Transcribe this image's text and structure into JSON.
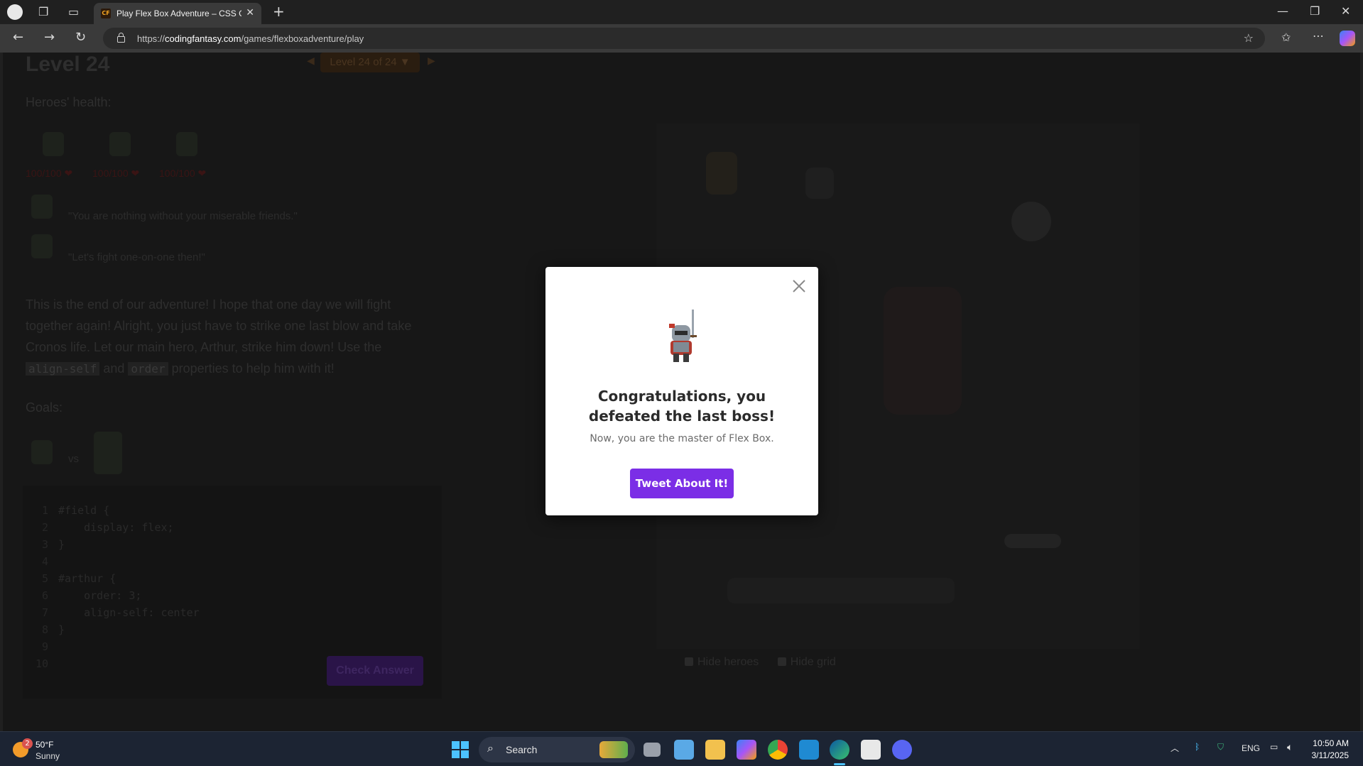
{
  "browser": {
    "tab_title": "Play Flex Box Adventure – CSS Ga",
    "tab_favicon_text": "CF",
    "url_prefix": "https://",
    "url_domain": "codingfantasy.com",
    "url_path": "/games/flexboxadventure/play"
  },
  "page": {
    "level_title": "Level 24",
    "level_nav": "Level 24 of 24 ▼",
    "health_label": "Heroes' health:",
    "hero_hp": [
      "100/100 ❤",
      "100/100 ❤",
      "100/100 ❤"
    ],
    "quote_boss": "\"You are nothing without your miserable friends.\"",
    "quote_hero": "\"Let's fight one-on-one then!\"",
    "story_part1": "This is the end of our adventure! I hope that one day we will fight together again! Alright, you just have to strike one last blow and take Cronos life. Let our main hero, Arthur, strike him down! Use the",
    "story_chip1": "align-self",
    "story_and": "and",
    "story_chip2": "order",
    "story_part2": "properties to help him with it!",
    "goals_label": "Goals:",
    "goals_vs": "vs",
    "code": {
      "lines": [
        "#field {",
        "    display: flex;",
        "}",
        "",
        "#arthur {",
        "    order: 3;",
        "    align-self: center",
        "}",
        "",
        ""
      ],
      "line_numbers": [
        "1",
        "2",
        "3",
        "4",
        "5",
        "6",
        "7",
        "8",
        "9",
        "10"
      ]
    },
    "check_button": "Check Answer",
    "hide_heroes": "Hide heroes",
    "hide_grid": "Hide grid"
  },
  "modal": {
    "title": "Congratulations, you defeated the last boss!",
    "subtitle": "Now, you are the master of Flex Box.",
    "button": "Tweet About It!"
  },
  "taskbar": {
    "weather_badge": "2",
    "weather_temp": "50°F",
    "weather_cond": "Sunny",
    "search_text": "Search",
    "tray_lang": "ENG",
    "clock_time": "10:50 AM",
    "clock_date": "3/11/2025"
  },
  "colors": {
    "modal_button": "#7b2ee6",
    "start_blue": "#4cc2ff",
    "overlay": "#171717"
  }
}
